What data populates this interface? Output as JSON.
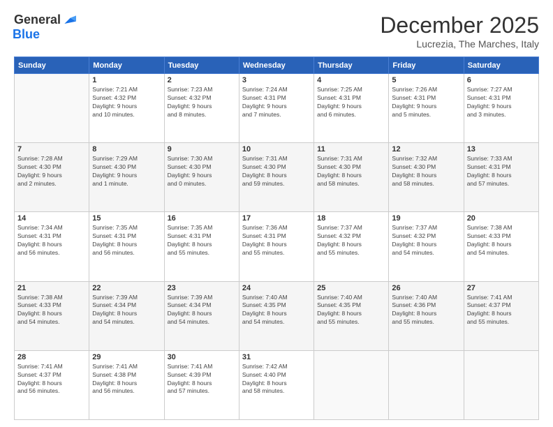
{
  "logo": {
    "general": "General",
    "blue": "Blue"
  },
  "title": "December 2025",
  "location": "Lucrezia, The Marches, Italy",
  "headers": [
    "Sunday",
    "Monday",
    "Tuesday",
    "Wednesday",
    "Thursday",
    "Friday",
    "Saturday"
  ],
  "weeks": [
    [
      {
        "day": "",
        "info": ""
      },
      {
        "day": "1",
        "info": "Sunrise: 7:21 AM\nSunset: 4:32 PM\nDaylight: 9 hours\nand 10 minutes."
      },
      {
        "day": "2",
        "info": "Sunrise: 7:23 AM\nSunset: 4:32 PM\nDaylight: 9 hours\nand 8 minutes."
      },
      {
        "day": "3",
        "info": "Sunrise: 7:24 AM\nSunset: 4:31 PM\nDaylight: 9 hours\nand 7 minutes."
      },
      {
        "day": "4",
        "info": "Sunrise: 7:25 AM\nSunset: 4:31 PM\nDaylight: 9 hours\nand 6 minutes."
      },
      {
        "day": "5",
        "info": "Sunrise: 7:26 AM\nSunset: 4:31 PM\nDaylight: 9 hours\nand 5 minutes."
      },
      {
        "day": "6",
        "info": "Sunrise: 7:27 AM\nSunset: 4:31 PM\nDaylight: 9 hours\nand 3 minutes."
      }
    ],
    [
      {
        "day": "7",
        "info": "Sunrise: 7:28 AM\nSunset: 4:30 PM\nDaylight: 9 hours\nand 2 minutes."
      },
      {
        "day": "8",
        "info": "Sunrise: 7:29 AM\nSunset: 4:30 PM\nDaylight: 9 hours\nand 1 minute."
      },
      {
        "day": "9",
        "info": "Sunrise: 7:30 AM\nSunset: 4:30 PM\nDaylight: 9 hours\nand 0 minutes."
      },
      {
        "day": "10",
        "info": "Sunrise: 7:31 AM\nSunset: 4:30 PM\nDaylight: 8 hours\nand 59 minutes."
      },
      {
        "day": "11",
        "info": "Sunrise: 7:31 AM\nSunset: 4:30 PM\nDaylight: 8 hours\nand 58 minutes."
      },
      {
        "day": "12",
        "info": "Sunrise: 7:32 AM\nSunset: 4:30 PM\nDaylight: 8 hours\nand 58 minutes."
      },
      {
        "day": "13",
        "info": "Sunrise: 7:33 AM\nSunset: 4:31 PM\nDaylight: 8 hours\nand 57 minutes."
      }
    ],
    [
      {
        "day": "14",
        "info": "Sunrise: 7:34 AM\nSunset: 4:31 PM\nDaylight: 8 hours\nand 56 minutes."
      },
      {
        "day": "15",
        "info": "Sunrise: 7:35 AM\nSunset: 4:31 PM\nDaylight: 8 hours\nand 56 minutes."
      },
      {
        "day": "16",
        "info": "Sunrise: 7:35 AM\nSunset: 4:31 PM\nDaylight: 8 hours\nand 55 minutes."
      },
      {
        "day": "17",
        "info": "Sunrise: 7:36 AM\nSunset: 4:31 PM\nDaylight: 8 hours\nand 55 minutes."
      },
      {
        "day": "18",
        "info": "Sunrise: 7:37 AM\nSunset: 4:32 PM\nDaylight: 8 hours\nand 55 minutes."
      },
      {
        "day": "19",
        "info": "Sunrise: 7:37 AM\nSunset: 4:32 PM\nDaylight: 8 hours\nand 54 minutes."
      },
      {
        "day": "20",
        "info": "Sunrise: 7:38 AM\nSunset: 4:33 PM\nDaylight: 8 hours\nand 54 minutes."
      }
    ],
    [
      {
        "day": "21",
        "info": "Sunrise: 7:38 AM\nSunset: 4:33 PM\nDaylight: 8 hours\nand 54 minutes."
      },
      {
        "day": "22",
        "info": "Sunrise: 7:39 AM\nSunset: 4:34 PM\nDaylight: 8 hours\nand 54 minutes."
      },
      {
        "day": "23",
        "info": "Sunrise: 7:39 AM\nSunset: 4:34 PM\nDaylight: 8 hours\nand 54 minutes."
      },
      {
        "day": "24",
        "info": "Sunrise: 7:40 AM\nSunset: 4:35 PM\nDaylight: 8 hours\nand 54 minutes."
      },
      {
        "day": "25",
        "info": "Sunrise: 7:40 AM\nSunset: 4:35 PM\nDaylight: 8 hours\nand 55 minutes."
      },
      {
        "day": "26",
        "info": "Sunrise: 7:40 AM\nSunset: 4:36 PM\nDaylight: 8 hours\nand 55 minutes."
      },
      {
        "day": "27",
        "info": "Sunrise: 7:41 AM\nSunset: 4:37 PM\nDaylight: 8 hours\nand 55 minutes."
      }
    ],
    [
      {
        "day": "28",
        "info": "Sunrise: 7:41 AM\nSunset: 4:37 PM\nDaylight: 8 hours\nand 56 minutes."
      },
      {
        "day": "29",
        "info": "Sunrise: 7:41 AM\nSunset: 4:38 PM\nDaylight: 8 hours\nand 56 minutes."
      },
      {
        "day": "30",
        "info": "Sunrise: 7:41 AM\nSunset: 4:39 PM\nDaylight: 8 hours\nand 57 minutes."
      },
      {
        "day": "31",
        "info": "Sunrise: 7:42 AM\nSunset: 4:40 PM\nDaylight: 8 hours\nand 58 minutes."
      },
      {
        "day": "",
        "info": ""
      },
      {
        "day": "",
        "info": ""
      },
      {
        "day": "",
        "info": ""
      }
    ]
  ],
  "row_shades": [
    "white",
    "shade",
    "white",
    "shade",
    "white"
  ]
}
